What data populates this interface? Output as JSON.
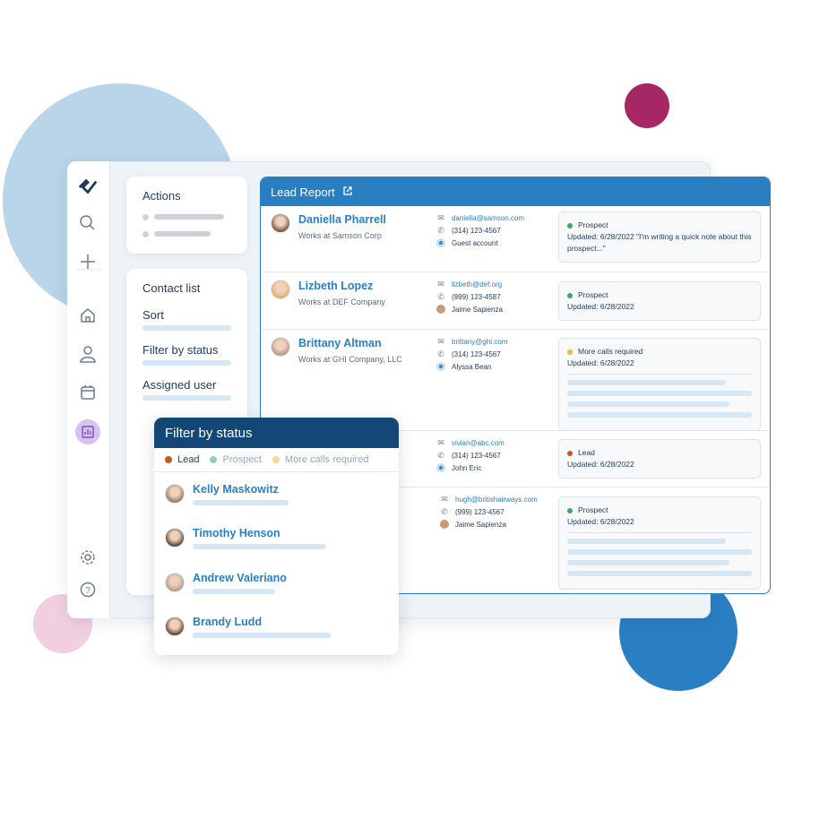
{
  "colors": {
    "accent": "#2a7fc2",
    "popup_header": "#134876",
    "lead": "#c85a1e",
    "prospect": "#3fa56b",
    "more_calls": "#e8b93a",
    "decor_light_blue": "#b8d5ea",
    "decor_magenta": "#a52864",
    "decor_pink": "#f2cfe0",
    "decor_blue": "#2a7fc2"
  },
  "sidebar": {
    "icons": [
      "logo-check-icon",
      "search-icon",
      "plus-icon",
      "home-icon",
      "user-icon",
      "calendar-icon",
      "reports-icon",
      "gear-icon",
      "help-icon"
    ],
    "active": "reports-icon"
  },
  "actions": {
    "title": "Actions"
  },
  "contact_list": {
    "title": "Contact list",
    "items": [
      {
        "label": "Sort"
      },
      {
        "label": "Filter by status"
      },
      {
        "label": "Assigned user"
      }
    ]
  },
  "report": {
    "title": "Lead Report",
    "rows": [
      {
        "name": "Daniella Pharrell",
        "company": "Works at Samson Corp",
        "email": "daniella@samson.com",
        "phone": "(314) 123-4567",
        "owner": "Guest account",
        "status": "Prospect",
        "status_key": "prospect",
        "updated": "Updated: 6/28/2022 \"I'm writing a quick note about this prospect...\"",
        "note_lines": 0
      },
      {
        "name": "Lizbeth Lopez",
        "company": "Works at DEF Company",
        "email": "lizbeth@def.org",
        "phone": "(999) 123-4587",
        "owner": "Jaime Sapienza",
        "status": "Prospect",
        "status_key": "prospect",
        "updated": "Updated: 6/28/2022",
        "note_lines": 0
      },
      {
        "name": "Brittany Altman",
        "company": "Works at GHI Company, LLC",
        "email": "brittany@ghi.com",
        "phone": "(314) 123-4567",
        "owner": "Alyssa Bean",
        "status": "More calls required",
        "status_key": "more_calls",
        "updated": "Updated: 6/28/2022",
        "note_lines": 4
      },
      {
        "name": "",
        "company": "",
        "email": "vivian@abc.com",
        "phone": "(314) 123-4567",
        "owner": "John Eric",
        "status": "Lead",
        "status_key": "lead",
        "updated": "Updated: 6/28/2022",
        "note_lines": 0
      },
      {
        "name": "",
        "company": "",
        "email": "hugh@britishairways.com",
        "phone": "(999) 123-4567",
        "owner": "Jaime Sapienza",
        "status": "Prospect",
        "status_key": "prospect",
        "updated": "Updated: 6/28/2022",
        "note_lines": 4
      }
    ]
  },
  "filter_popup": {
    "title": "Filter by status",
    "legend": [
      {
        "label": "Lead",
        "key": "lead"
      },
      {
        "label": "Prospect",
        "key": "prospect"
      },
      {
        "label": "More calls required",
        "key": "more_calls"
      }
    ],
    "people": [
      {
        "name": "Kelly Maskowitz"
      },
      {
        "name": "Timothy Henson"
      },
      {
        "name": "Andrew Valeriano"
      },
      {
        "name": "Brandy Ludd"
      }
    ]
  }
}
